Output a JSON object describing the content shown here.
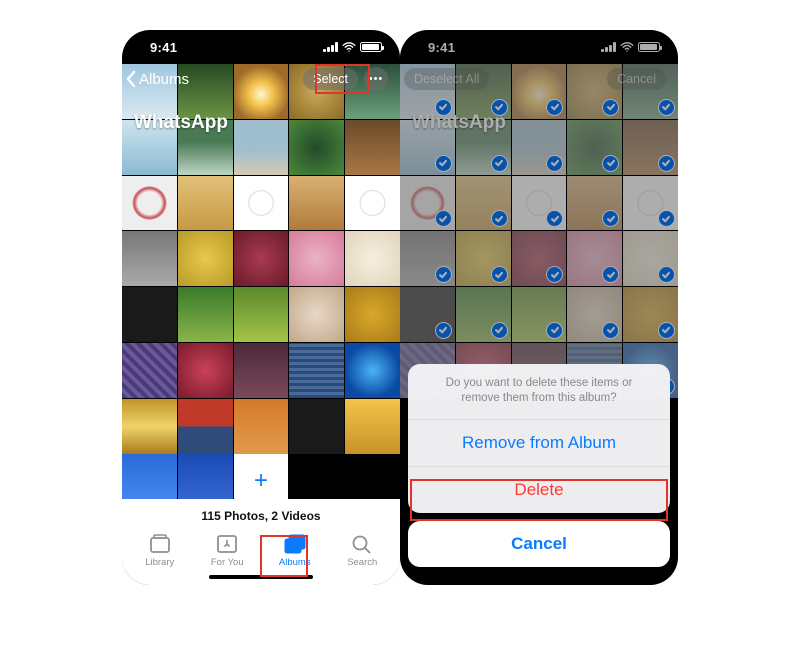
{
  "status_time": "9:41",
  "back_label": "Albums",
  "album_title": "WhatsApp",
  "select_button": "Select",
  "deselect_button": "Deselect All",
  "cancel_top": "Cancel",
  "more_glyph": "•••",
  "add_glyph": "+",
  "footer_count": "115 Photos, 2 Videos",
  "tabs": {
    "library": "Library",
    "foryou": "For You",
    "albums": "Albums",
    "search": "Search"
  },
  "sheet": {
    "message": "Do you want to delete these items or remove them from this album?",
    "remove": "Remove from Album",
    "delete": "Delete",
    "cancel": "Cancel"
  },
  "thumbs": [
    "g-sky",
    "g-forest",
    "g-sun",
    "g-flowers",
    "g-cactus",
    "g-ice",
    "g-moun",
    "g-beach",
    "g-fern",
    "g-wood",
    "g-salad",
    "g-giraf",
    "g-plate",
    "g-warm",
    "g-plate",
    "g-rocks",
    "g-yell",
    "g-berry",
    "g-pink",
    "g-eggs",
    "g-dark",
    "g-veg",
    "g-veg2",
    "g-cake",
    "g-pep",
    "g-pat1",
    "g-pat2",
    "g-pat3",
    "g-pat4",
    "g-blue",
    "g-gold",
    "g-stripe",
    "g-orange",
    "g-dark",
    "g-sun2",
    "g-blue2",
    "g-blue3"
  ]
}
